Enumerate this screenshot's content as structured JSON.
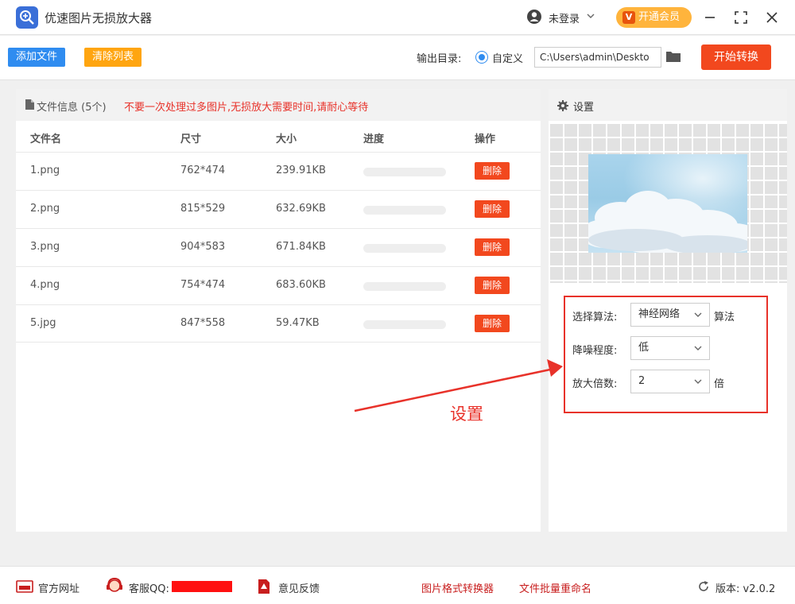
{
  "app": {
    "title": "优速图片无损放大器"
  },
  "header": {
    "login_text": "未登录",
    "vip_label": "开通会员",
    "vip_mark": "V"
  },
  "toolbar": {
    "add_label": "添加文件",
    "clear_label": "清除列表",
    "output_label": "输出目录:",
    "radio_label": "自定义",
    "output_path": "C:\\Users\\admin\\Deskto",
    "start_label": "开始转换"
  },
  "file_list": {
    "title": "文件信息 (5个)",
    "warning": "不要一次处理过多图片,无损放大需要时间,请耐心等待",
    "headers": {
      "name": "文件名",
      "size": "尺寸",
      "filesize": "大小",
      "progress": "进度",
      "action": "操作"
    },
    "delete_label": "删除",
    "rows": [
      {
        "name": "1.png",
        "dims": "762*474",
        "size": "239.91KB",
        "progress": 0
      },
      {
        "name": "2.png",
        "dims": "815*529",
        "size": "632.69KB",
        "progress": 0
      },
      {
        "name": "3.png",
        "dims": "904*583",
        "size": "671.84KB",
        "progress": 0
      },
      {
        "name": "4.png",
        "dims": "754*474",
        "size": "683.60KB",
        "progress": 0
      },
      {
        "name": "5.jpg",
        "dims": "847*558",
        "size": "59.47KB",
        "progress": 0
      }
    ]
  },
  "settings": {
    "title": "设置",
    "algo_label": "选择算法:",
    "algo_value": "神经网络",
    "algo_suffix": "算法",
    "noise_label": "降噪程度:",
    "noise_value": "低",
    "scale_label": "放大倍数:",
    "scale_value": "2",
    "scale_suffix": "倍",
    "annotation": "设置"
  },
  "footer": {
    "website": "官方网址",
    "support": "客服QQ:",
    "feedback": "意见反馈",
    "format_converter": "图片格式转换器",
    "batch_rename": "文件批量重命名",
    "version": "版本: v2.0.2"
  },
  "colors": {
    "accent_blue": "#2f8cf0",
    "accent_orange": "#ffa510",
    "danger": "#f2481e",
    "annotation_red": "#e8322a"
  }
}
